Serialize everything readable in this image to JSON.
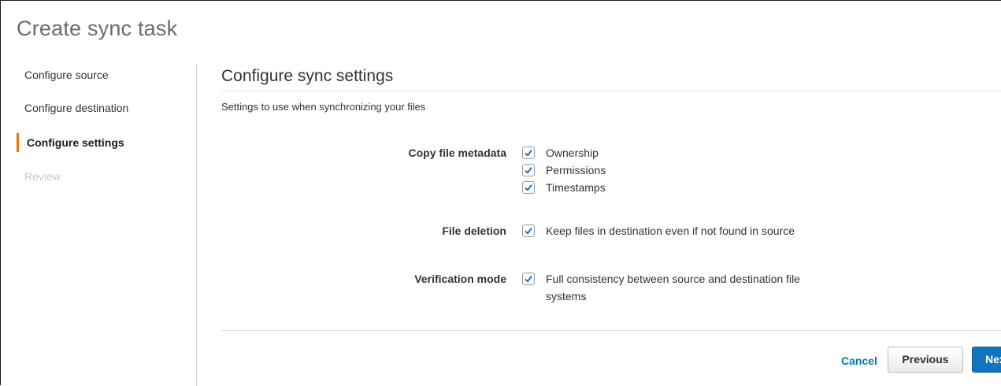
{
  "page": {
    "title": "Create sync task"
  },
  "steps": [
    {
      "label": "Configure source",
      "state": "done"
    },
    {
      "label": "Configure destination",
      "state": "done"
    },
    {
      "label": "Configure settings",
      "state": "active"
    },
    {
      "label": "Review",
      "state": "disabled"
    }
  ],
  "section": {
    "title": "Configure sync settings",
    "description": "Settings to use when synchronizing your files"
  },
  "fields": {
    "metadata": {
      "label": "Copy file metadata",
      "options": [
        {
          "label": "Ownership",
          "checked": true
        },
        {
          "label": "Permissions",
          "checked": true
        },
        {
          "label": "Timestamps",
          "checked": true
        }
      ]
    },
    "deletion": {
      "label": "File deletion",
      "option": {
        "label": "Keep files in destination even if not found in source",
        "checked": true
      }
    },
    "verification": {
      "label": "Verification mode",
      "option": {
        "label_line1": "Full consistency between source and destination file",
        "label_line2": "systems",
        "checked": true
      }
    }
  },
  "footer": {
    "cancel": "Cancel",
    "previous": "Previous",
    "next": "Next"
  },
  "colors": {
    "accent_step": "#e7760b",
    "link_blue": "#0073bb",
    "primary_button": "#0f75c0",
    "checkmark": "#1f6fb5"
  }
}
